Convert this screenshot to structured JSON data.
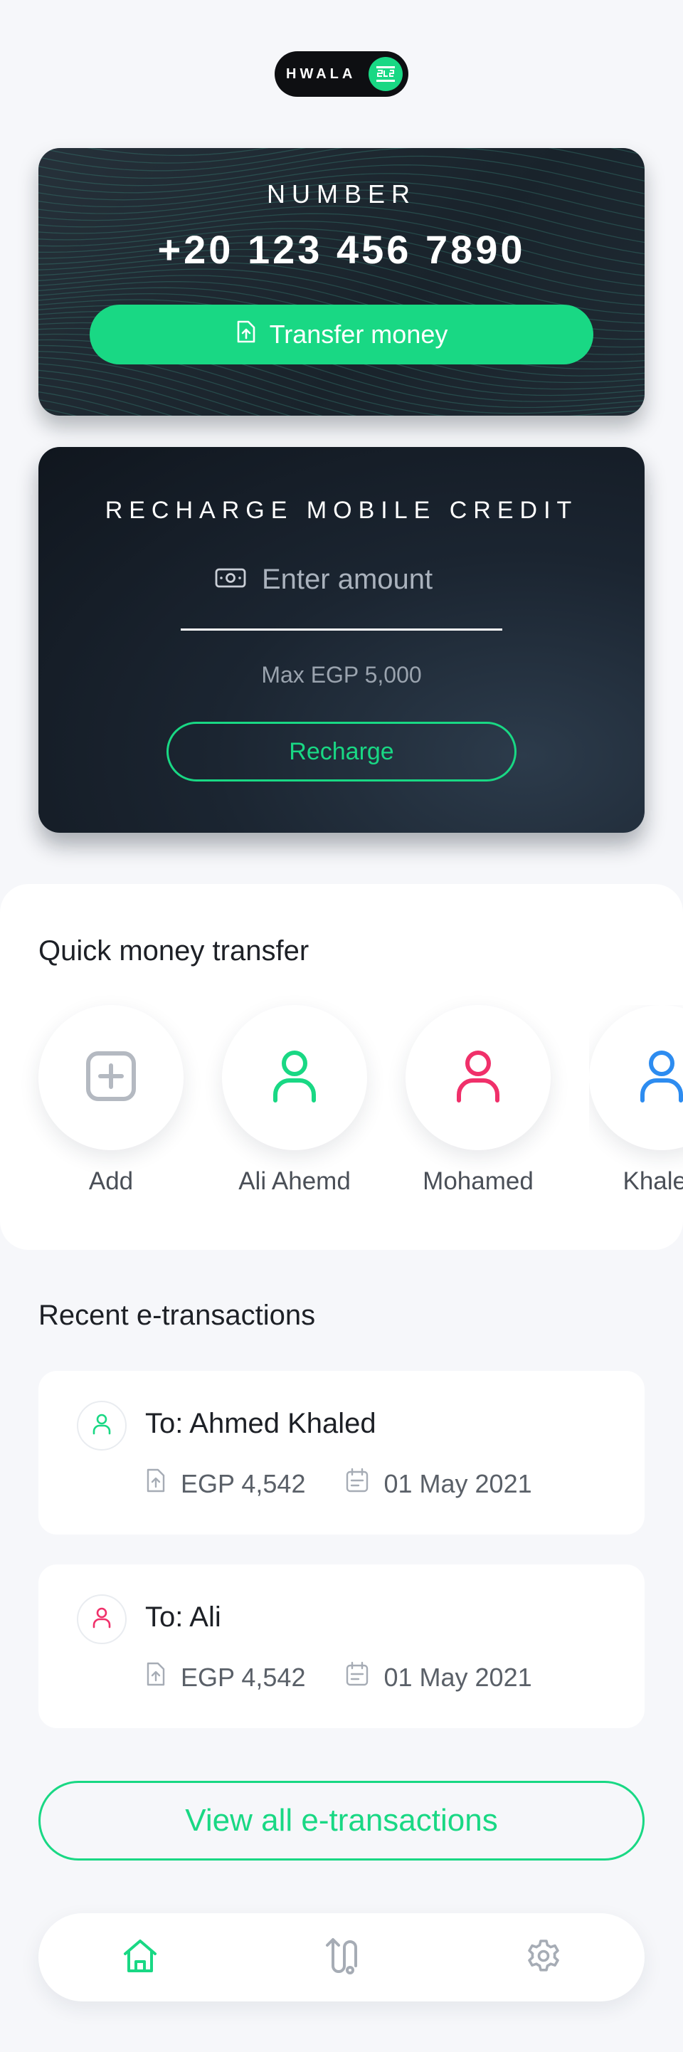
{
  "app": {
    "logo_text": "HWALA"
  },
  "number_card": {
    "label": "NUMBER",
    "phone_number": "+20 123 456 7890",
    "transfer_button_label": "Transfer money"
  },
  "recharge_card": {
    "title": "RECHARGE MOBILE CREDIT",
    "amount_placeholder": "Enter amount",
    "max_text": "Max EGP 5,000",
    "recharge_button_label": "Recharge"
  },
  "quick_transfer": {
    "title": "Quick money transfer",
    "contacts": [
      {
        "name": "Add",
        "icon": "plus-square-icon",
        "color": "#b4b9c1"
      },
      {
        "name": "Ali Ahemd",
        "icon": "user-icon",
        "color": "#19d884"
      },
      {
        "name": "Mohamed",
        "icon": "user-icon",
        "color": "#f0306a"
      },
      {
        "name": "Khaled",
        "icon": "user-icon",
        "color": "#2d8cf0"
      }
    ]
  },
  "recent": {
    "title": "Recent e-transactions",
    "transactions": [
      {
        "name": "To: Ahmed Khaled",
        "amount": "EGP 4,542",
        "date": "01 May 2021",
        "avatar_color": "#19d884"
      },
      {
        "name": "To: Ali",
        "amount": "EGP 4,542",
        "date": "01 May 2021",
        "avatar_color": "#f0306a"
      }
    ],
    "view_all_label": "View all e-transactions"
  },
  "bottom_nav": {
    "items": [
      {
        "icon": "home-icon",
        "active": true
      },
      {
        "icon": "route-icon",
        "active": false
      },
      {
        "icon": "gear-icon",
        "active": false
      }
    ]
  },
  "colors": {
    "accent": "#19d884",
    "pink": "#f0306a",
    "blue": "#2d8cf0",
    "dark_card": "#1b2531"
  }
}
